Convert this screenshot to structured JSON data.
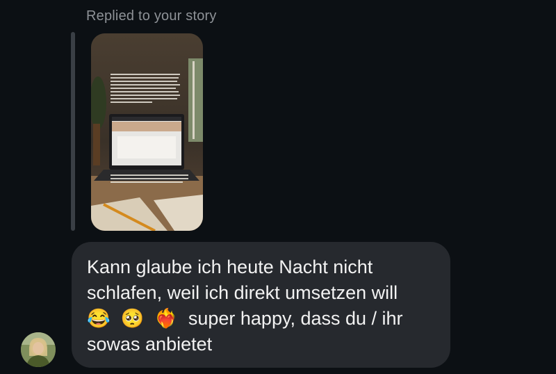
{
  "reply_context": {
    "label": "Replied to your story"
  },
  "story": {
    "overlay_text_top": "Ich habe mit den Unternehmern - so jede das konsistente Programm weiss auf ein Einzelprodukt, warum einen / oft Klienten wie ... aber was Wert auf Grenzen setzen ... tragend ... damit ... wenn ... Wert für mich",
    "overlay_text_bottom": "Was macht jetzt schon bei dir ... die Entwicklung, an ... wird Coache"
  },
  "message": {
    "text": "Kann glaube ich heute Nacht nicht\nschlafen, weil ich direkt umsetzen will\n😂  🥺  ❤️‍🔥  super happy, dass du / ihr\nsowas anbietet"
  },
  "colors": {
    "background": "#0c1014",
    "bubble": "#26292e",
    "muted_text": "#8e9297",
    "message_text": "#f2f2f2"
  }
}
